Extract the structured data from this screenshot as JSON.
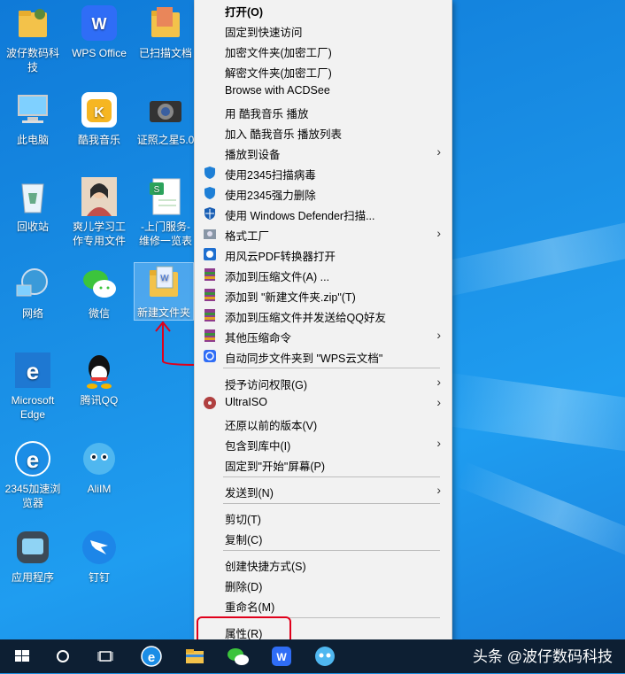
{
  "desktop": {
    "icons": [
      {
        "label": "波仔数码科技",
        "icon": "folder-person-icon"
      },
      {
        "label": "WPS Office",
        "icon": "wps-icon"
      },
      {
        "label": "已扫描文档",
        "icon": "folder-icon"
      },
      {
        "label": "此电脑",
        "icon": "computer-icon"
      },
      {
        "label": "酷我音乐",
        "icon": "kuwo-icon"
      },
      {
        "label": "证照之星5.0",
        "icon": "camera-icon"
      },
      {
        "label": "回收站",
        "icon": "recycle-bin-icon"
      },
      {
        "label": "爽儿学习工作专用文件",
        "icon": "photo-icon"
      },
      {
        "label": "-上门服务-维修一览表",
        "icon": "spreadsheet-icon"
      },
      {
        "label": "网络",
        "icon": "network-icon"
      },
      {
        "label": "微信",
        "icon": "wechat-icon"
      },
      {
        "label": "新建文件夹",
        "icon": "folder-doc-icon"
      },
      {
        "label": "Microsoft Edge",
        "icon": "edge-icon"
      },
      {
        "label": "腾讯QQ",
        "icon": "qq-icon"
      },
      {
        "label": "2345加速浏览器",
        "icon": "browser-2345-icon"
      },
      {
        "label": "AliIM",
        "icon": "aliim-icon"
      },
      {
        "label": "应用程序",
        "icon": "apps-icon"
      },
      {
        "label": "钉钉",
        "icon": "dingtalk-icon"
      }
    ]
  },
  "context_menu": {
    "items": [
      {
        "label": "打开(O)"
      },
      {
        "label": "固定到快速访问"
      },
      {
        "label": "加密文件夹(加密工厂)"
      },
      {
        "label": "解密文件夹(加密工厂)"
      },
      {
        "label": "Browse with ACDSee"
      },
      {
        "label": "用 酷我音乐 播放"
      },
      {
        "label": "加入 酷我音乐 播放列表"
      },
      {
        "label": "播放到设备"
      },
      {
        "label": "使用2345扫描病毒"
      },
      {
        "label": "使用2345强力删除"
      },
      {
        "label": "使用 Windows Defender扫描..."
      },
      {
        "label": "格式工厂"
      },
      {
        "label": "用风云PDF转换器打开"
      },
      {
        "label": "添加到压缩文件(A) ..."
      },
      {
        "label": "添加到 \"新建文件夹.zip\"(T)"
      },
      {
        "label": "添加到压缩文件并发送给QQ好友"
      },
      {
        "label": "其他压缩命令"
      },
      {
        "label": "自动同步文件夹到 \"WPS云文档\""
      },
      {
        "label": "授予访问权限(G)"
      },
      {
        "label": "UltraISO"
      },
      {
        "label": "还原以前的版本(V)"
      },
      {
        "label": "包含到库中(I)"
      },
      {
        "label": "固定到\"开始\"屏幕(P)"
      },
      {
        "label": "发送到(N)"
      },
      {
        "label": "剪切(T)"
      },
      {
        "label": "复制(C)"
      },
      {
        "label": "创建快捷方式(S)"
      },
      {
        "label": "删除(D)"
      },
      {
        "label": "重命名(M)"
      },
      {
        "label": "属性(R)"
      }
    ],
    "submenu_arrow": "›"
  },
  "taskbar": {
    "watermark": "头条 @波仔数码科技"
  },
  "colors": {
    "annotation": "#e0001b",
    "taskbar": "#0d1f33",
    "menu_bg": "#f2f2f2"
  }
}
